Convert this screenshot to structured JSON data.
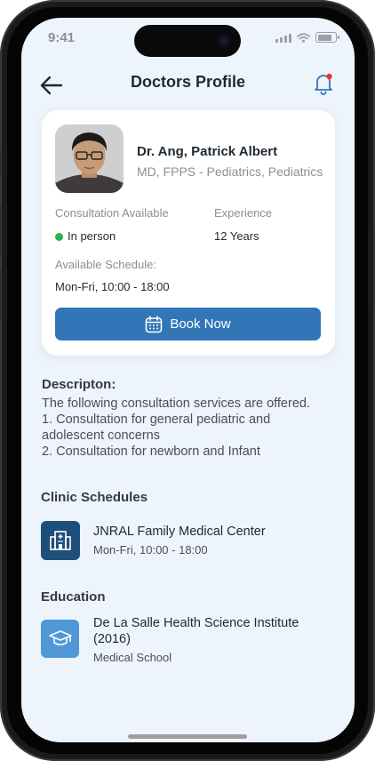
{
  "status_bar": {
    "time": "9:41"
  },
  "header": {
    "title": "Doctors Profile"
  },
  "doctor": {
    "name": "Dr. Ang, Patrick Albert",
    "credentials": "MD, FPPS - Pediatrics, Pediatrics",
    "consultation_label": "Consultation Available",
    "consultation_value": "In person",
    "experience_label": "Experience",
    "experience_value": "12 Years",
    "schedule_label": "Available Schedule:",
    "schedule_value": "Mon-Fri, 10:00 - 18:00",
    "book_label": "Book Now"
  },
  "description": {
    "title": "Descripton:",
    "lines": [
      "The following consultation services are offered.",
      "1. Consultation for general pediatric and",
      "adolescent concerns",
      "2. Consultation for newborn and Infant"
    ]
  },
  "clinic": {
    "title": "Clinic Schedules",
    "name": "JNRAL Family Medical Center",
    "hours": "Mon-Fri, 10:00 - 18:00"
  },
  "education": {
    "title": "Education",
    "school_line1": "De La Salle Health Science Institute",
    "school_line2": "(2016)",
    "degree": "Medical School"
  },
  "colors": {
    "primary": "#3276b8",
    "clinic_icon_bg": "#1e4e7a",
    "education_icon_bg": "#4f97d6",
    "available_dot": "#2cb34a",
    "screen_bg": "#eef4fb"
  }
}
